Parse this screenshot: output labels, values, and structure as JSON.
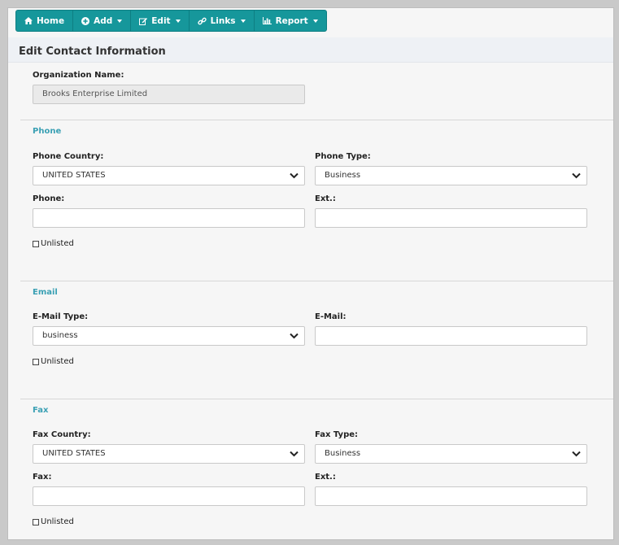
{
  "toolbar": {
    "home": "Home",
    "add": "Add",
    "edit": "Edit",
    "links": "Links",
    "report": "Report"
  },
  "page": {
    "title": "Edit Contact Information"
  },
  "organization": {
    "label": "Organization Name:",
    "value": "Brooks Enterprise Limited"
  },
  "phone": {
    "section": "Phone",
    "country_label": "Phone Country:",
    "country_value": "UNITED STATES",
    "type_label": "Phone Type:",
    "type_value": "Business",
    "phone_label": "Phone:",
    "phone_value": "",
    "ext_label": "Ext.:",
    "ext_value": "",
    "unlisted": "Unlisted"
  },
  "email": {
    "section": "Email",
    "type_label": "E-Mail Type:",
    "type_value": "business",
    "email_label": "E-Mail:",
    "email_value": "",
    "unlisted": "Unlisted"
  },
  "fax": {
    "section": "Fax",
    "country_label": "Fax Country:",
    "country_value": "UNITED STATES",
    "type_label": "Fax Type:",
    "type_value": "Business",
    "fax_label": "Fax:",
    "fax_value": "",
    "ext_label": "Ext.:",
    "ext_value": "",
    "unlisted": "Unlisted"
  },
  "colors": {
    "toolbar": "#16979b",
    "section_title": "#3aa0b4"
  }
}
